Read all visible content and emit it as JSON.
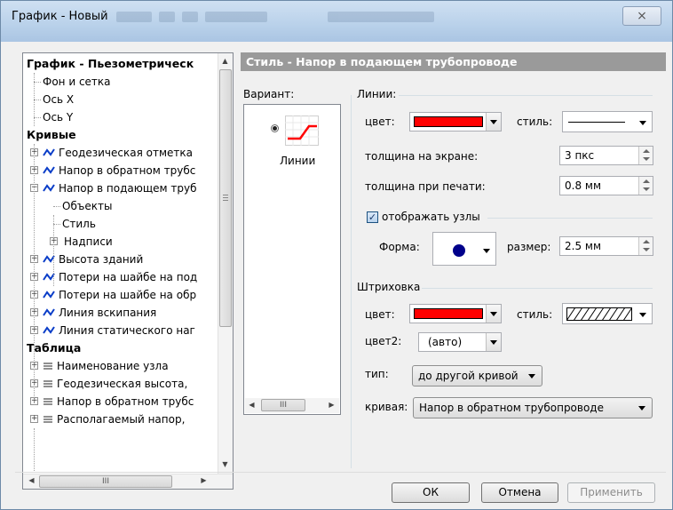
{
  "window": {
    "title": "График - Новый",
    "close_glyph": "⨯"
  },
  "tree": {
    "rows": [
      {
        "label": "График - Пьезометрическ",
        "style": "bold",
        "indent": 0,
        "icon": "none"
      },
      {
        "label": "Фон и сетка",
        "indent": 1,
        "icon": "none"
      },
      {
        "label": "Ось X",
        "indent": 1,
        "icon": "none"
      },
      {
        "label": "Ось Y",
        "indent": 1,
        "icon": "none"
      },
      {
        "label": "Кривые",
        "style": "bold",
        "indent": 0,
        "icon": "none"
      },
      {
        "label": "Геодезическая отметка",
        "indent": 1,
        "icon": "wave-icon",
        "expander": "+"
      },
      {
        "label": "Напор в обратном трубс",
        "indent": 1,
        "icon": "wave-icon",
        "expander": "+"
      },
      {
        "label": "Напор в подающем труб",
        "indent": 1,
        "icon": "wave-icon",
        "expander": "-"
      },
      {
        "label": "Объекты",
        "indent": 2,
        "icon": "none"
      },
      {
        "label": "Стиль",
        "indent": 2,
        "icon": "none"
      },
      {
        "label": "Надписи",
        "indent": 2,
        "icon": "none",
        "expander": "+"
      },
      {
        "label": "Высота зданий",
        "indent": 1,
        "icon": "wave-icon",
        "expander": "+"
      },
      {
        "label": "Потери на шайбе на под",
        "indent": 1,
        "icon": "wave-icon",
        "expander": "+"
      },
      {
        "label": "Потери на шайбе на обр",
        "indent": 1,
        "icon": "wave-icon",
        "expander": "+"
      },
      {
        "label": "Линия вскипания",
        "indent": 1,
        "icon": "wave-icon",
        "expander": "+"
      },
      {
        "label": "Линия статического наг",
        "indent": 1,
        "icon": "wave-icon",
        "expander": "+"
      },
      {
        "label": "Таблица",
        "style": "bold",
        "indent": 0,
        "icon": "none"
      },
      {
        "label": "Наименование узла",
        "indent": 1,
        "icon": "lines-icon",
        "expander": "+"
      },
      {
        "label": "Геодезическая высота,",
        "indent": 1,
        "icon": "lines-icon",
        "expander": "+"
      },
      {
        "label": "Напор в обратном трубс",
        "indent": 1,
        "icon": "lines-icon",
        "expander": "+"
      },
      {
        "label": "Располагаемый напор,",
        "indent": 1,
        "icon": "lines-icon",
        "expander": "+"
      }
    ],
    "hscroll_grip": "III"
  },
  "panel": {
    "header": "Стиль - Напор в подающем трубопроводе",
    "variant_label": "Вариант:",
    "variant_item_label": "Линии",
    "lines_group": "Линии:",
    "color_label": "цвет:",
    "line_color": "#ff0000",
    "style_label": "стиль:",
    "screen_thickness_label": "толщина на экране:",
    "screen_thickness_value": "3 пкс",
    "print_thickness_label": "толщина при печати:",
    "print_thickness_value": "0.8 мм",
    "show_nodes_label": "отображать узлы",
    "show_nodes_checked": true,
    "shape_label": "Форма:",
    "size_label": "размер:",
    "size_value": "2.5 мм",
    "node_color": "#00008b",
    "hatch_group": "Штриховка",
    "hatch_color_label": "цвет:",
    "hatch_color": "#ff0000",
    "hatch_style_label": "стиль:",
    "color2_label": "цвет2:",
    "color2_value": "(авто)",
    "type_label": "тип:",
    "type_value": "до другой кривой",
    "curve_label": "кривая:",
    "curve_value": "Напор в обратном трубопроводе"
  },
  "buttons": {
    "ok": "ОК",
    "cancel": "Отмена",
    "apply": "Применить"
  }
}
